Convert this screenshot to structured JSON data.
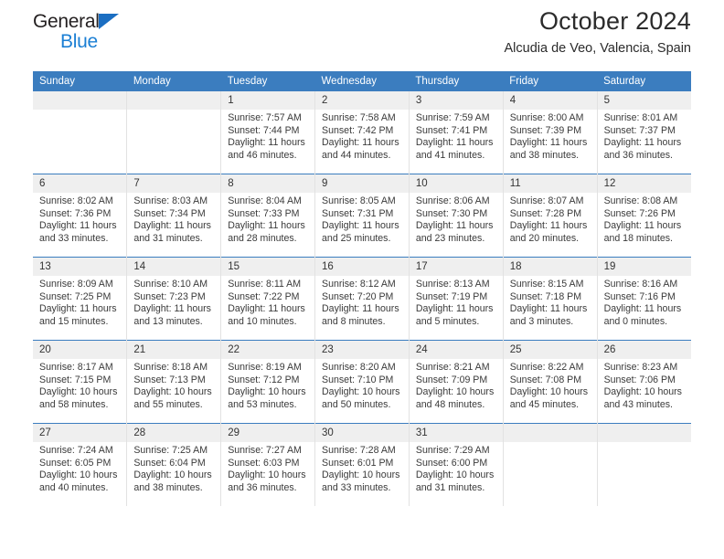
{
  "brand": {
    "name_part1": "General",
    "name_part2": "Blue",
    "triangle_color": "#1b6ec2",
    "blue_color": "#1b7fd4"
  },
  "header": {
    "title": "October 2024",
    "subtitle": "Alcudia de Veo, Valencia, Spain"
  },
  "theme": {
    "header_bg": "#3b7dbf",
    "daynum_bg": "#efefef",
    "week_divider": "#3b7dbf",
    "column_divider": "#e2e2e2"
  },
  "weekdays": [
    "Sunday",
    "Monday",
    "Tuesday",
    "Wednesday",
    "Thursday",
    "Friday",
    "Saturday"
  ],
  "labels": {
    "sunrise_prefix": "Sunrise:",
    "sunset_prefix": "Sunset:",
    "daylight_prefix": "Daylight:"
  },
  "weeks": [
    [
      {
        "day": "",
        "empty": true
      },
      {
        "day": "",
        "empty": true
      },
      {
        "day": "1",
        "sunrise": "Sunrise: 7:57 AM",
        "sunset": "Sunset: 7:44 PM",
        "daylight": "Daylight: 11 hours and 46 minutes."
      },
      {
        "day": "2",
        "sunrise": "Sunrise: 7:58 AM",
        "sunset": "Sunset: 7:42 PM",
        "daylight": "Daylight: 11 hours and 44 minutes."
      },
      {
        "day": "3",
        "sunrise": "Sunrise: 7:59 AM",
        "sunset": "Sunset: 7:41 PM",
        "daylight": "Daylight: 11 hours and 41 minutes."
      },
      {
        "day": "4",
        "sunrise": "Sunrise: 8:00 AM",
        "sunset": "Sunset: 7:39 PM",
        "daylight": "Daylight: 11 hours and 38 minutes."
      },
      {
        "day": "5",
        "sunrise": "Sunrise: 8:01 AM",
        "sunset": "Sunset: 7:37 PM",
        "daylight": "Daylight: 11 hours and 36 minutes."
      }
    ],
    [
      {
        "day": "6",
        "sunrise": "Sunrise: 8:02 AM",
        "sunset": "Sunset: 7:36 PM",
        "daylight": "Daylight: 11 hours and 33 minutes."
      },
      {
        "day": "7",
        "sunrise": "Sunrise: 8:03 AM",
        "sunset": "Sunset: 7:34 PM",
        "daylight": "Daylight: 11 hours and 31 minutes."
      },
      {
        "day": "8",
        "sunrise": "Sunrise: 8:04 AM",
        "sunset": "Sunset: 7:33 PM",
        "daylight": "Daylight: 11 hours and 28 minutes."
      },
      {
        "day": "9",
        "sunrise": "Sunrise: 8:05 AM",
        "sunset": "Sunset: 7:31 PM",
        "daylight": "Daylight: 11 hours and 25 minutes."
      },
      {
        "day": "10",
        "sunrise": "Sunrise: 8:06 AM",
        "sunset": "Sunset: 7:30 PM",
        "daylight": "Daylight: 11 hours and 23 minutes."
      },
      {
        "day": "11",
        "sunrise": "Sunrise: 8:07 AM",
        "sunset": "Sunset: 7:28 PM",
        "daylight": "Daylight: 11 hours and 20 minutes."
      },
      {
        "day": "12",
        "sunrise": "Sunrise: 8:08 AM",
        "sunset": "Sunset: 7:26 PM",
        "daylight": "Daylight: 11 hours and 18 minutes."
      }
    ],
    [
      {
        "day": "13",
        "sunrise": "Sunrise: 8:09 AM",
        "sunset": "Sunset: 7:25 PM",
        "daylight": "Daylight: 11 hours and 15 minutes."
      },
      {
        "day": "14",
        "sunrise": "Sunrise: 8:10 AM",
        "sunset": "Sunset: 7:23 PM",
        "daylight": "Daylight: 11 hours and 13 minutes."
      },
      {
        "day": "15",
        "sunrise": "Sunrise: 8:11 AM",
        "sunset": "Sunset: 7:22 PM",
        "daylight": "Daylight: 11 hours and 10 minutes."
      },
      {
        "day": "16",
        "sunrise": "Sunrise: 8:12 AM",
        "sunset": "Sunset: 7:20 PM",
        "daylight": "Daylight: 11 hours and 8 minutes."
      },
      {
        "day": "17",
        "sunrise": "Sunrise: 8:13 AM",
        "sunset": "Sunset: 7:19 PM",
        "daylight": "Daylight: 11 hours and 5 minutes."
      },
      {
        "day": "18",
        "sunrise": "Sunrise: 8:15 AM",
        "sunset": "Sunset: 7:18 PM",
        "daylight": "Daylight: 11 hours and 3 minutes."
      },
      {
        "day": "19",
        "sunrise": "Sunrise: 8:16 AM",
        "sunset": "Sunset: 7:16 PM",
        "daylight": "Daylight: 11 hours and 0 minutes."
      }
    ],
    [
      {
        "day": "20",
        "sunrise": "Sunrise: 8:17 AM",
        "sunset": "Sunset: 7:15 PM",
        "daylight": "Daylight: 10 hours and 58 minutes."
      },
      {
        "day": "21",
        "sunrise": "Sunrise: 8:18 AM",
        "sunset": "Sunset: 7:13 PM",
        "daylight": "Daylight: 10 hours and 55 minutes."
      },
      {
        "day": "22",
        "sunrise": "Sunrise: 8:19 AM",
        "sunset": "Sunset: 7:12 PM",
        "daylight": "Daylight: 10 hours and 53 minutes."
      },
      {
        "day": "23",
        "sunrise": "Sunrise: 8:20 AM",
        "sunset": "Sunset: 7:10 PM",
        "daylight": "Daylight: 10 hours and 50 minutes."
      },
      {
        "day": "24",
        "sunrise": "Sunrise: 8:21 AM",
        "sunset": "Sunset: 7:09 PM",
        "daylight": "Daylight: 10 hours and 48 minutes."
      },
      {
        "day": "25",
        "sunrise": "Sunrise: 8:22 AM",
        "sunset": "Sunset: 7:08 PM",
        "daylight": "Daylight: 10 hours and 45 minutes."
      },
      {
        "day": "26",
        "sunrise": "Sunrise: 8:23 AM",
        "sunset": "Sunset: 7:06 PM",
        "daylight": "Daylight: 10 hours and 43 minutes."
      }
    ],
    [
      {
        "day": "27",
        "sunrise": "Sunrise: 7:24 AM",
        "sunset": "Sunset: 6:05 PM",
        "daylight": "Daylight: 10 hours and 40 minutes."
      },
      {
        "day": "28",
        "sunrise": "Sunrise: 7:25 AM",
        "sunset": "Sunset: 6:04 PM",
        "daylight": "Daylight: 10 hours and 38 minutes."
      },
      {
        "day": "29",
        "sunrise": "Sunrise: 7:27 AM",
        "sunset": "Sunset: 6:03 PM",
        "daylight": "Daylight: 10 hours and 36 minutes."
      },
      {
        "day": "30",
        "sunrise": "Sunrise: 7:28 AM",
        "sunset": "Sunset: 6:01 PM",
        "daylight": "Daylight: 10 hours and 33 minutes."
      },
      {
        "day": "31",
        "sunrise": "Sunrise: 7:29 AM",
        "sunset": "Sunset: 6:00 PM",
        "daylight": "Daylight: 10 hours and 31 minutes."
      },
      {
        "day": "",
        "empty": true
      },
      {
        "day": "",
        "empty": true
      }
    ]
  ]
}
